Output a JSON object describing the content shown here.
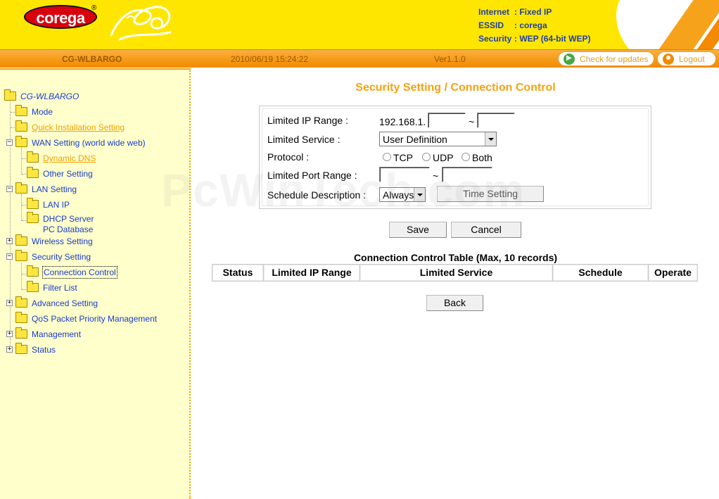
{
  "header": {
    "logo_text": "corega",
    "logo_mark": "®",
    "internet_label": "Internet",
    "internet_value": ": Fixed IP",
    "essid_label": "ESSID",
    "essid_value": ": corega",
    "security_label": "Security",
    "security_value": ": WEP (64-bit WEP)"
  },
  "topbar": {
    "device": "CG-WLBARGO",
    "datetime": "2010/06/19 15:24:22",
    "version": "Ver1.1.0",
    "check_updates": "Check for updates",
    "logout": "Logout"
  },
  "sidebar": {
    "root": "CG-WLBARGO",
    "items": {
      "mode": "Mode",
      "quick_install": "Quick Installation Setting",
      "wan": "WAN Setting (world wide web)",
      "dynamic_dns": "Dynamic DNS",
      "other_setting": "Other Setting",
      "lan": "LAN Setting",
      "lan_ip": "LAN IP",
      "dhcp_server": "DHCP Server",
      "pc_database": "PC Database",
      "wireless": "Wireless Setting",
      "security": "Security Setting",
      "connection_control": "Connection Control",
      "filter_list": "Filter List",
      "advanced": "Advanced Setting",
      "qos": "QoS Packet Priority Management",
      "management": "Management",
      "status": "Status"
    }
  },
  "main": {
    "title": "Security Setting / Connection Control",
    "form": {
      "ip_range_label": "Limited IP Range :",
      "ip_prefix": "192.168.1.",
      "ip_from": "",
      "tilde": "~",
      "ip_to": "",
      "service_label": "Limited Service :",
      "service_value": "User Definition",
      "protocol_label": "Protocol :",
      "protocol_tcp": "TCP",
      "protocol_udp": "UDP",
      "protocol_both": "Both",
      "port_range_label": "Limited Port Range :",
      "port_from": "",
      "port_to": "",
      "schedule_label": "Schedule Description :",
      "schedule_value": "Always",
      "time_setting": "Time Setting"
    },
    "save": "Save",
    "cancel": "Cancel",
    "table": {
      "title": "Connection Control Table (Max, 10 records)",
      "columns": [
        "Status",
        "Limited IP Range",
        "Limited Service",
        "Schedule",
        "Operate"
      ]
    },
    "back": "Back"
  },
  "watermark": "PcWinTech.com",
  "colors": {
    "header_yellow": "#ffe600",
    "bar_orange": "#f59a17",
    "title_orange": "#f7a20f",
    "link_blue": "#1a3cc8",
    "sidebar_bg": "#ffffcc"
  }
}
